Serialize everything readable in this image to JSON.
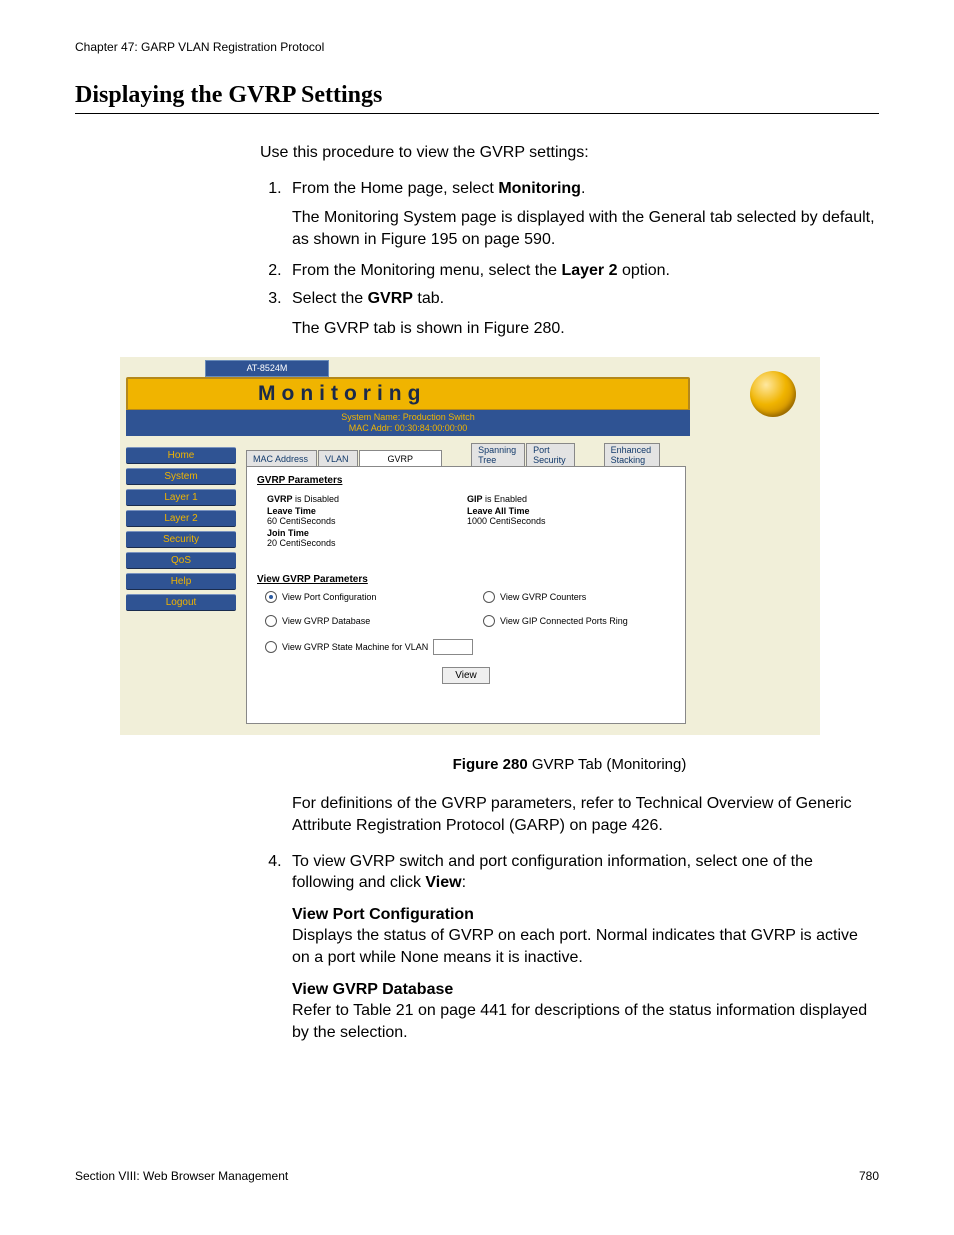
{
  "header": {
    "chapter": "Chapter 47: GARP VLAN Registration Protocol"
  },
  "title": "Displaying the GVRP Settings",
  "intro": "Use this procedure to view the GVRP settings:",
  "steps": {
    "s1a": "From the Home page, select ",
    "s1b": "Monitoring",
    "s1c": ".",
    "s1_para": "The Monitoring System page is displayed with the General tab selected by default, as shown in Figure 195 on page 590.",
    "s2a": "From the Monitoring menu, select the ",
    "s2b": "Layer 2",
    "s2c": " option.",
    "s3a": "Select the ",
    "s3b": "GVRP",
    "s3c": " tab.",
    "s3_para": "The GVRP tab is shown in Figure 280.",
    "s4a": "To view GVRP switch and port configuration information, select one of the following and click ",
    "s4b": "View",
    "s4c": ":"
  },
  "figure": {
    "model": "AT-8524M",
    "title": "Monitoring",
    "sys_name": "System Name: Production Switch",
    "mac": "MAC Addr: 00:30:84:00:00:00",
    "nav": {
      "home": "Home",
      "system": "System",
      "layer1": "Layer 1",
      "layer2": "Layer 2",
      "security": "Security",
      "qos": "QoS",
      "help": "Help",
      "logout": "Logout"
    },
    "tabs": {
      "mac": "MAC Address",
      "vlan": "VLAN",
      "gvrp": "GVRP",
      "spanning": "Spanning\nTree",
      "port": "Port\nSecurity",
      "enhanced": "Enhanced\nStacking"
    },
    "panel": {
      "params_title": "GVRP Parameters",
      "p1a": "GVRP",
      "p1b": " is Disabled",
      "p2a": "Leave Time",
      "p2b": "60 CentiSeconds",
      "p3a": "Join Time",
      "p3b": "20 CentiSeconds",
      "p4a": "GIP",
      "p4b": " is Enabled",
      "p5a": "Leave All Time",
      "p5b": "1000 CentiSeconds",
      "view_title": "View GVRP Parameters",
      "opt1": "View Port Configuration",
      "opt2": "View GVRP Counters",
      "opt3": "View GVRP Database",
      "opt4": "View GIP Connected Ports Ring",
      "opt5": "View GVRP State Machine for VLAN",
      "view_btn": "View"
    }
  },
  "caption": {
    "bold": "Figure 280",
    "rest": "  GVRP Tab (Monitoring)"
  },
  "after_fig": "For definitions of the GVRP parameters, refer to Technical Overview of Generic Attribute Registration Protocol (GARP) on page 426.",
  "defs": {
    "d1t": "View Port Configuration",
    "d1b": "Displays the status of GVRP on each port. Normal indicates that GVRP is active on a port while None means it is inactive.",
    "d2t": "View GVRP Database",
    "d2b": "Refer to Table 21 on page 441 for descriptions of the status information displayed by the selection."
  },
  "footer": {
    "section": "Section VIII: Web Browser Management",
    "page": "780"
  }
}
